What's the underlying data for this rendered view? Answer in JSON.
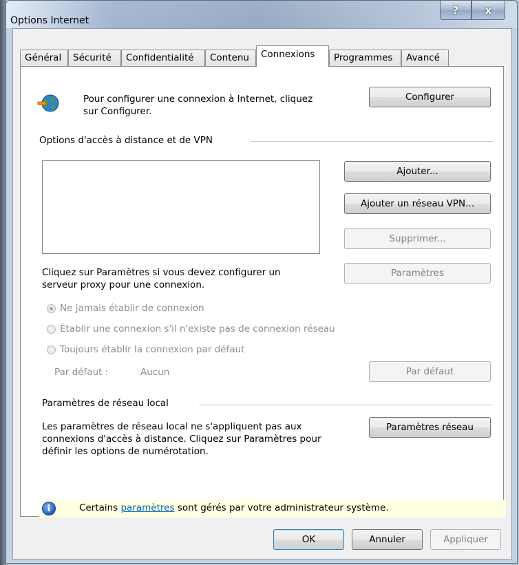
{
  "window": {
    "title": "Options Internet",
    "help_glyph": "?",
    "close_glyph": "x"
  },
  "tabs": [
    {
      "label": "Général"
    },
    {
      "label": "Sécurité"
    },
    {
      "label": "Confidentialité"
    },
    {
      "label": "Contenu"
    },
    {
      "label": "Connexions"
    },
    {
      "label": "Programmes"
    },
    {
      "label": "Avancé"
    }
  ],
  "active_tab": "Connexions",
  "setup": {
    "text_line1": "Pour configurer une connexion à Internet, cliquez",
    "text_line2": "sur Configurer.",
    "button": "Configurer",
    "icon": "globe-connection-icon"
  },
  "dialup": {
    "heading": "Options d'accès à distance et de VPN",
    "add_button": "Ajouter...",
    "add_vpn_button": "Ajouter un réseau VPN...",
    "remove_button": "Supprimer...",
    "settings_button": "Paramètres",
    "proxy_text_line1": "Cliquez sur Paramètres si vous devez configurer un",
    "proxy_text_line2": "serveur proxy pour une connexion.",
    "radios": [
      {
        "label": "Ne jamais établir de connexion",
        "checked": true
      },
      {
        "label": "Établir une connexion s'il n'existe pas de connexion réseau",
        "checked": false
      },
      {
        "label": "Toujours établir la connexion par défaut",
        "checked": false
      }
    ],
    "default_label": "Par défaut :",
    "default_value": "Aucun",
    "set_default_button": "Par défaut"
  },
  "lan": {
    "heading": "Paramètres de réseau local",
    "text_line1": "Les paramètres de réseau local ne s'appliquent pas aux",
    "text_line2": "connexions d'accès à distance. Cliquez sur Paramètres pour",
    "text_line3": "définir les options de numérotation.",
    "button": "Paramètres réseau"
  },
  "info": {
    "prefix": "Certains ",
    "link": "paramètres",
    "suffix": " sont gérés par votre administrateur système."
  },
  "footer": {
    "ok": "OK",
    "cancel": "Annuler",
    "apply": "Appliquer"
  },
  "colors": {
    "info_background": "#ffffe1",
    "link": "#0066cc",
    "disabled_text": "#838383"
  }
}
